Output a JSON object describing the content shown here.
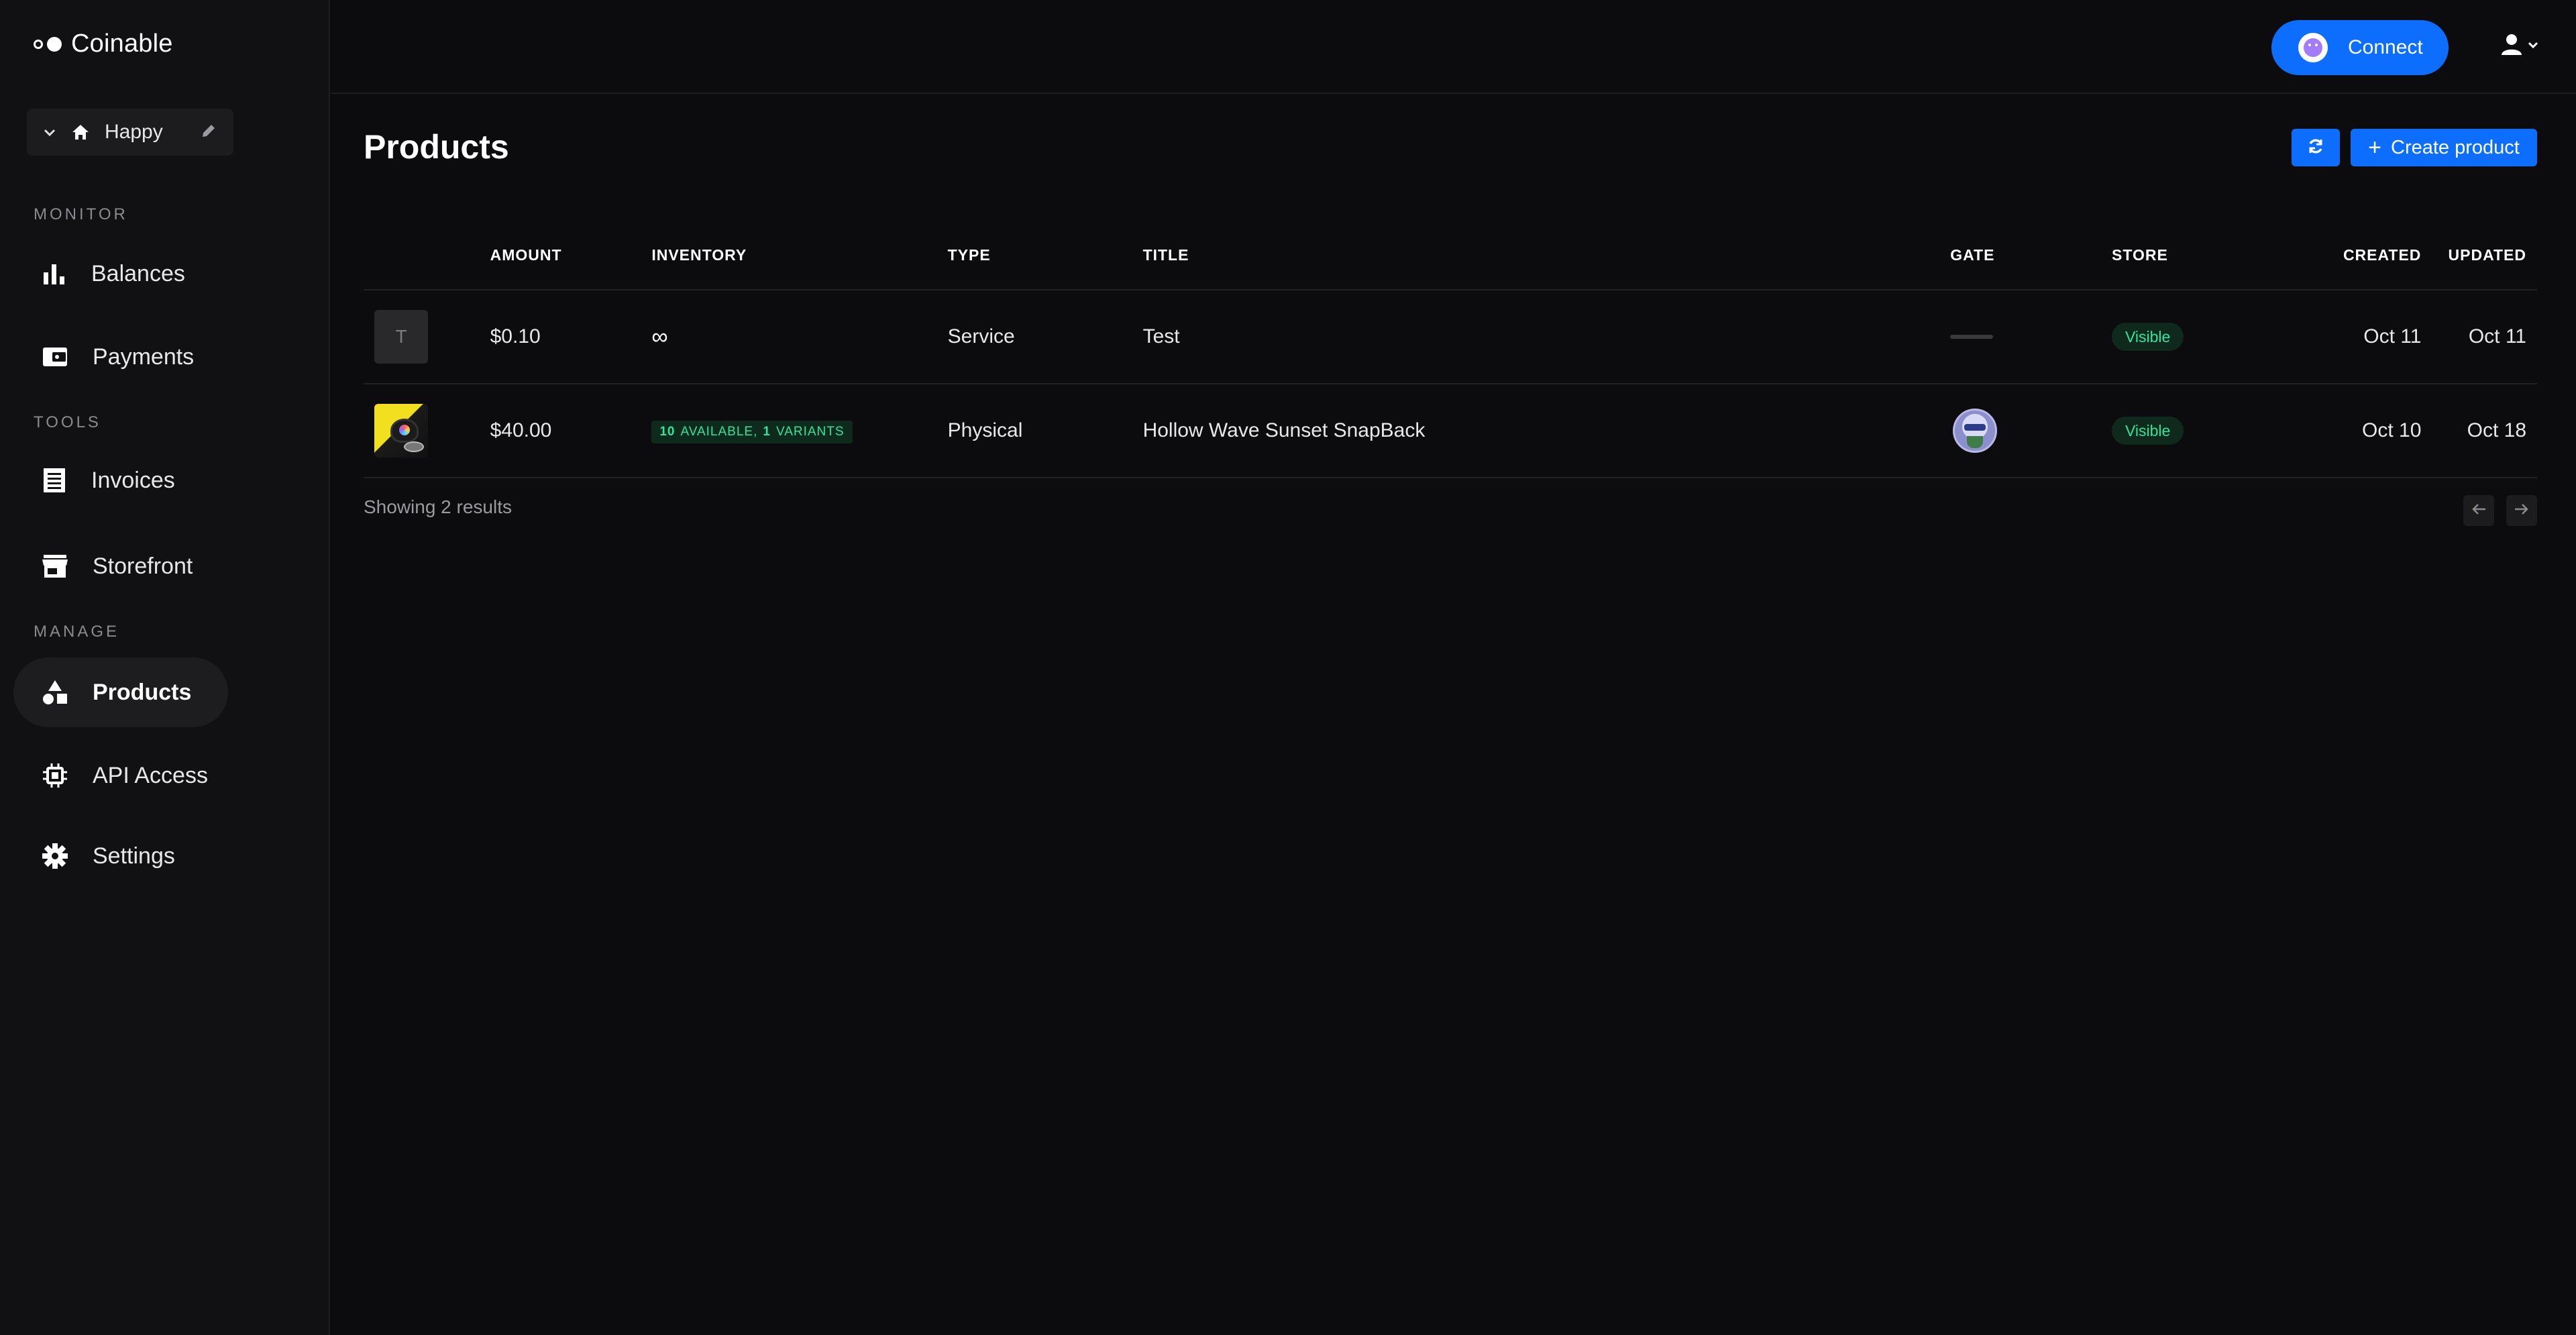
{
  "app": {
    "name": "Coinable"
  },
  "store_switcher": {
    "name": "Happy"
  },
  "sidebar": {
    "sections": [
      "MONITOR",
      "TOOLS",
      "MANAGE"
    ],
    "items": [
      {
        "label": "Balances",
        "icon": "bar-chart-icon"
      },
      {
        "label": "Payments",
        "icon": "wallet-icon"
      },
      {
        "label": "Invoices",
        "icon": "receipt-icon"
      },
      {
        "label": "Storefront",
        "icon": "storefront-icon"
      },
      {
        "label": "Products",
        "icon": "shapes-icon",
        "active": true
      },
      {
        "label": "API Access",
        "icon": "chip-icon"
      },
      {
        "label": "Settings",
        "icon": "gear-icon"
      }
    ]
  },
  "topbar": {
    "connect_label": "Connect"
  },
  "page": {
    "title": "Products",
    "create_label": "Create product",
    "results_text": "Showing 2 results"
  },
  "table": {
    "headers": {
      "amount": "AMOUNT",
      "inventory": "INVENTORY",
      "type": "TYPE",
      "title": "TITLE",
      "gate": "GATE",
      "store": "STORE",
      "created": "CREATED",
      "updated": "UPDATED"
    },
    "rows": [
      {
        "thumb_letter": "T",
        "amount": "$0.10",
        "inventory": "∞",
        "type": "Service",
        "title": "Test",
        "store": "Visible",
        "created": "Oct 11",
        "updated": "Oct 11"
      },
      {
        "amount": "$40.00",
        "inventory_available": "10",
        "inventory_available_label": "AVAILABLE,",
        "inventory_variants": "1",
        "inventory_variants_label": "VARIANTS",
        "type": "Physical",
        "title": "Hollow Wave Sunset SnapBack",
        "store": "Visible",
        "created": "Oct 10",
        "updated": "Oct 18"
      }
    ]
  },
  "colors": {
    "accent": "#0d6efd",
    "background": "#0c0c0e",
    "sidebar": "#111113",
    "success": "#2ee59d"
  }
}
